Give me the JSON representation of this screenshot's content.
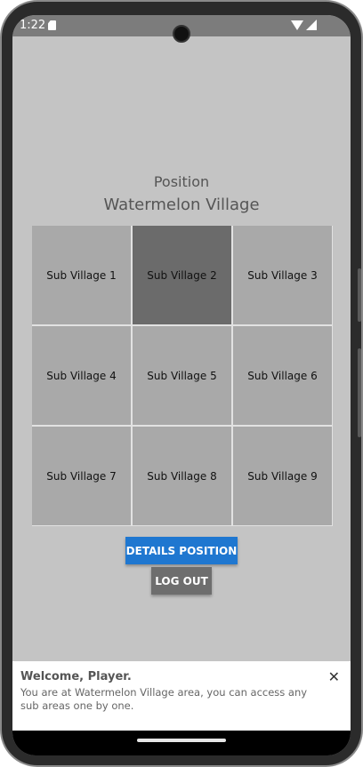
{
  "status_bar": {
    "time": "1:22",
    "icons": [
      "sd-card-icon",
      "wifi-icon",
      "signal-icon"
    ]
  },
  "header": {
    "position_label": "Position",
    "village_name": "Watermelon Village"
  },
  "grid": {
    "cells": [
      {
        "label": "Sub Village 1",
        "selected": false
      },
      {
        "label": "Sub Village 2",
        "selected": true
      },
      {
        "label": "Sub Village 3",
        "selected": false
      },
      {
        "label": "Sub Village 4",
        "selected": false
      },
      {
        "label": "Sub Village 5",
        "selected": false
      },
      {
        "label": "Sub Village 6",
        "selected": false
      },
      {
        "label": "Sub Village 7",
        "selected": false
      },
      {
        "label": "Sub Village 8",
        "selected": false
      },
      {
        "label": "Sub Village 9",
        "selected": false
      }
    ]
  },
  "actions": {
    "details_label": "DETAILS POSITION",
    "logout_label": "LOG OUT"
  },
  "toast": {
    "title": "Welcome, Player.",
    "message": "You are at Watermelon Village area, you can access any sub areas one by one.",
    "close_symbol": "✕"
  },
  "colors": {
    "background": "#c4c4c4",
    "cell": "#a9a9a9",
    "cell_selected": "#6b6b6b",
    "primary_button": "#1f77d0",
    "logout_button": "#6e6e6e"
  }
}
